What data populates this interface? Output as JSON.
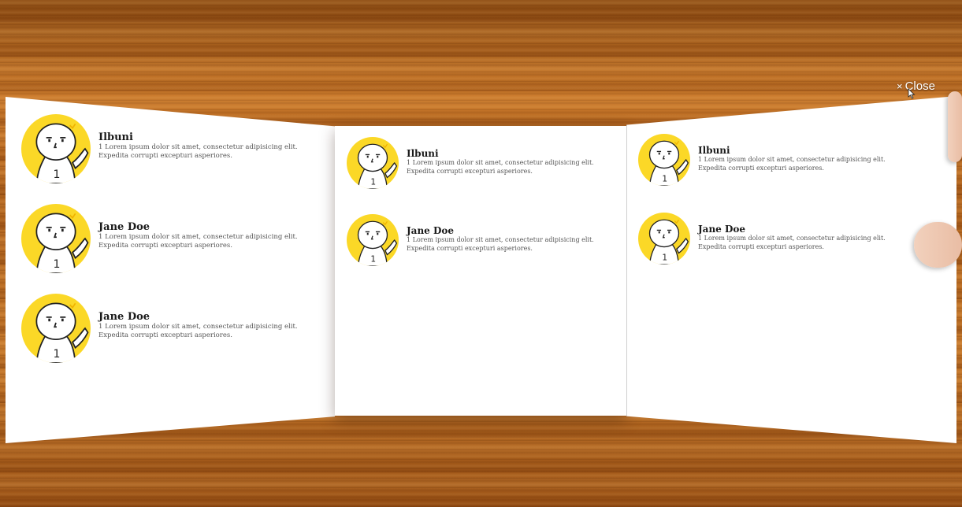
{
  "close": {
    "icon": "×",
    "label": "Close"
  },
  "left_panel": {
    "cards": [
      {
        "name": "Ilbuni",
        "desc": "1 Lorem ipsum dolor sit amet, consectetur adipisicing elit. Expedita corrupti excepturi asperiores."
      },
      {
        "name": "Jane Doe",
        "desc": "1 Lorem ipsum dolor sit amet, consectetur adipisicing elit. Expedita corrupti excepturi asperiores."
      },
      {
        "name": "Jane Doe",
        "desc": "1 Lorem ipsum dolor sit amet, consectetur adipisicing elit. Expedita corrupti excepturi asperiores."
      }
    ]
  },
  "center_panel": {
    "cards": [
      {
        "name": "Ilbuni",
        "desc": "1 Lorem ipsum dolor sit amet, consectetur adipisicing elit. Expedita corrupti excepturi asperiores."
      },
      {
        "name": "Jane Doe",
        "desc": "1 Lorem ipsum dolor sit amet, consectetur adipisicing elit. Expedita corrupti excepturi asperiores."
      }
    ]
  },
  "right_panel": {
    "cards": [
      {
        "name": "Ilbuni",
        "desc": "1 Lorem ipsum dolor sit amet, consectetur adipisicing elit. Expedita corrupti excepturi asperiores."
      },
      {
        "name": "Jane Doe",
        "desc": "1 Lorem ipsum dolor sit amet, consectetur adipisicing elit. Expedita corrupti excepturi asperiores."
      }
    ]
  },
  "avatar": {
    "badge": "1",
    "background": "#fbd827"
  }
}
